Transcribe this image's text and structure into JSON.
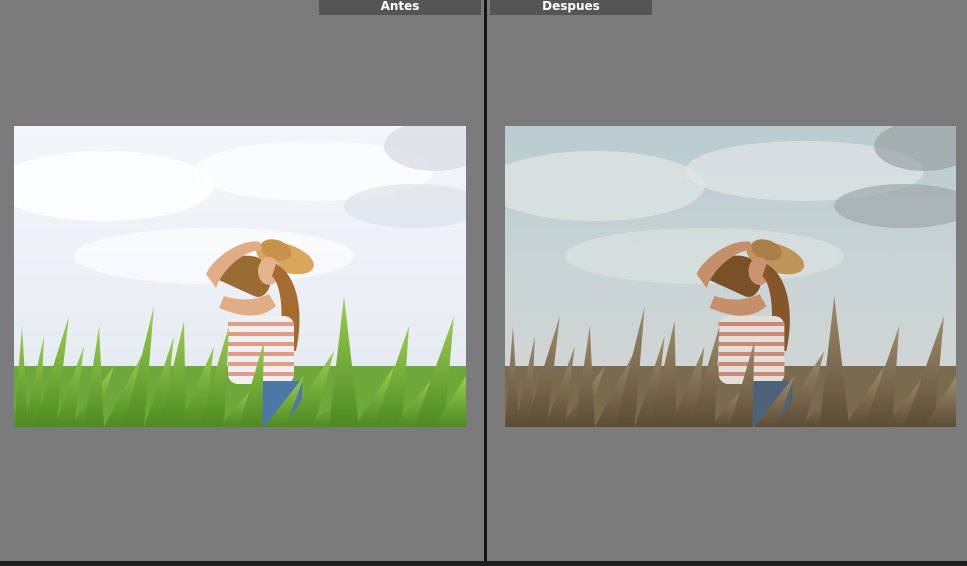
{
  "compare_view": {
    "before": {
      "label": "Antes",
      "photo": "woman-in-grass-field-photo-original"
    },
    "after": {
      "label": "Despues",
      "photo": "woman-in-grass-field-photo-edited"
    }
  },
  "colors": {
    "background": "#7b7b7b",
    "divider": "#141414",
    "label_bg": "#555555",
    "label_text": "#ffffff"
  }
}
